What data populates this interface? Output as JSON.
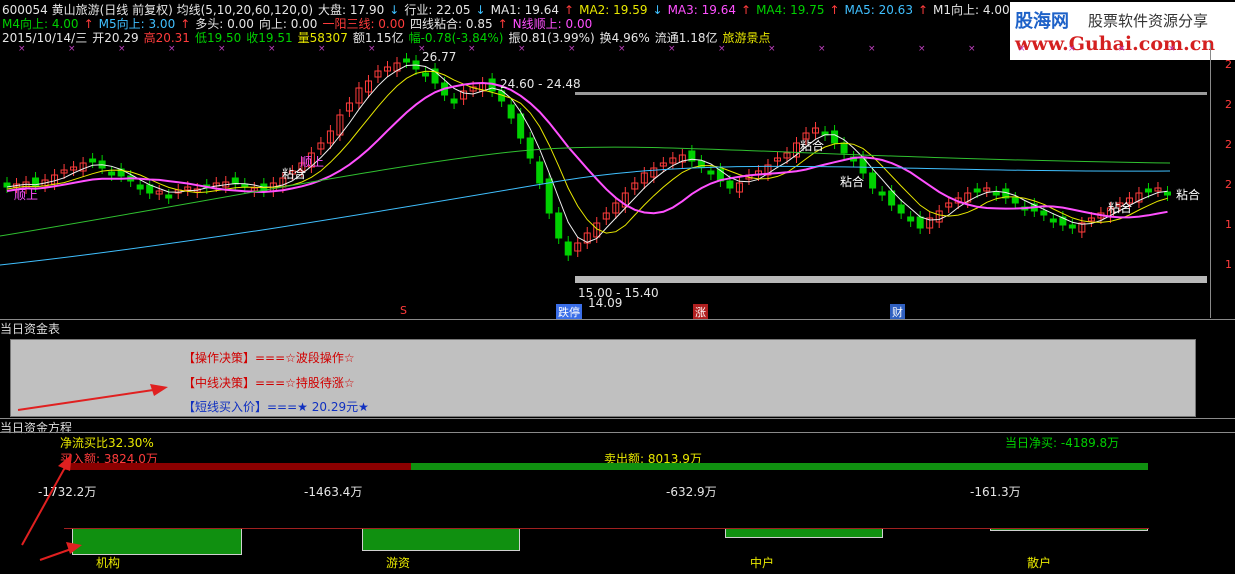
{
  "header": {
    "line1": [
      {
        "text": "600054 黄山旅游(日线 前复权) 均线(5,10,20,60,120,0)",
        "color": "#e6e6e6"
      },
      {
        "text": "大盘: 17.90",
        "color": "#e6e6e6"
      },
      {
        "text": "↓",
        "color": "#40c0ff"
      },
      {
        "text": "行业: 22.05",
        "color": "#e6e6e6"
      },
      {
        "text": "↓",
        "color": "#40c0ff"
      },
      {
        "text": "MA1: 19.64",
        "color": "#e6e6e6"
      },
      {
        "text": "↑",
        "color": "#ff3c3c"
      },
      {
        "text": "MA2: 19.59",
        "color": "#e8e800"
      },
      {
        "text": "↓",
        "color": "#40c0ff"
      },
      {
        "text": "MA3: 19.64",
        "color": "#ff50ff"
      },
      {
        "text": "↑",
        "color": "#ff3c3c"
      },
      {
        "text": "MA4: 19.75",
        "color": "#00d000"
      },
      {
        "text": "↑",
        "color": "#ff3c3c"
      },
      {
        "text": "MA5: 20.63",
        "color": "#40c0ff"
      },
      {
        "text": "↑",
        "color": "#ff3c3c"
      },
      {
        "text": "M1向上: 4.00",
        "color": "#e6e6e6"
      },
      {
        "text": "↑",
        "color": "#ff3c3c"
      }
    ],
    "line2": [
      {
        "text": "M4向上: 4.00",
        "color": "#00d000"
      },
      {
        "text": "↑",
        "color": "#ff3c3c"
      },
      {
        "text": "M5向上: 3.00",
        "color": "#40c0ff"
      },
      {
        "text": "↑",
        "color": "#ff3c3c"
      },
      {
        "text": "多头: 0.00",
        "color": "#e6e6e6"
      },
      {
        "text": "向上: 0.00",
        "color": "#e6e6e6"
      },
      {
        "text": "一阳三线: 0.00",
        "color": "#ff3c3c"
      },
      {
        "text": "四线粘合: 0.85",
        "color": "#e6e6e6"
      },
      {
        "text": "↑",
        "color": "#ff3c3c"
      },
      {
        "text": "N线顺上: 0.00",
        "color": "#ff50ff"
      }
    ],
    "line3": [
      {
        "text": "2015/10/14/三",
        "color": "#e6e6e6"
      },
      {
        "text": "开20.29",
        "color": "#e6e6e6"
      },
      {
        "text": "高20.31",
        "color": "#ff3c3c"
      },
      {
        "text": "低19.50",
        "color": "#00d000"
      },
      {
        "text": "收19.51",
        "color": "#00d000"
      },
      {
        "text": "量58307",
        "color": "#e8e800"
      },
      {
        "text": "额1.15亿",
        "color": "#e6e6e6"
      },
      {
        "text": "幅-0.78(-3.84%)",
        "color": "#00d000"
      },
      {
        "text": "振0.81(3.99%)",
        "color": "#e6e6e6"
      },
      {
        "text": "换4.96%",
        "color": "#e6e6e6"
      },
      {
        "text": "流通1.18亿",
        "color": "#e6e6e6"
      },
      {
        "text": "旅游景点",
        "color": "#e8e800"
      }
    ]
  },
  "logo": {
    "line1": "股海网",
    "line2": "股票软件资源分享",
    "url": "www.Guhai.com.cn"
  },
  "chart": {
    "price_high_label": "26.77",
    "zone_high_label": "24.60 - 24.48",
    "zone_low_label": "15.00 - 15.40",
    "price_low_label": "14.09",
    "annotations": [
      "粘合",
      "粘合",
      "粘合",
      "粘合",
      "粘合",
      "粘合"
    ],
    "shun_labels": [
      "顺上",
      "顺上"
    ],
    "bottom_markers": {
      "s": "S",
      "zhangting": "跌停",
      "zhang": "涨",
      "cai": "财"
    },
    "axis_ticks": [
      "2",
      "2",
      "2",
      "2",
      "1",
      "1",
      "1"
    ]
  },
  "panel1": {
    "title": "当日资金表",
    "decision1": "【操作决策】===☆波段操作☆",
    "decision2": "【中线决策】===☆持股待涨☆",
    "decision3": "【短线买入价】===★ 20.29元★"
  },
  "panel2": {
    "title": "当日资金方程",
    "net_ratio": "净流买比32.30%",
    "buy_amount": "买入额: 3824.0万",
    "sell_amount": "卖出额: 8013.9万",
    "net_buy": "当日净买: -4189.8万",
    "values": [
      "-1732.2万",
      "-1463.4万",
      "-632.9万",
      "-161.3万"
    ],
    "categories": [
      "机构",
      "游资",
      "中户",
      "散户"
    ],
    "bar_values": [
      -1732.2,
      -1463.4,
      -632.9,
      -161.3
    ]
  }
}
